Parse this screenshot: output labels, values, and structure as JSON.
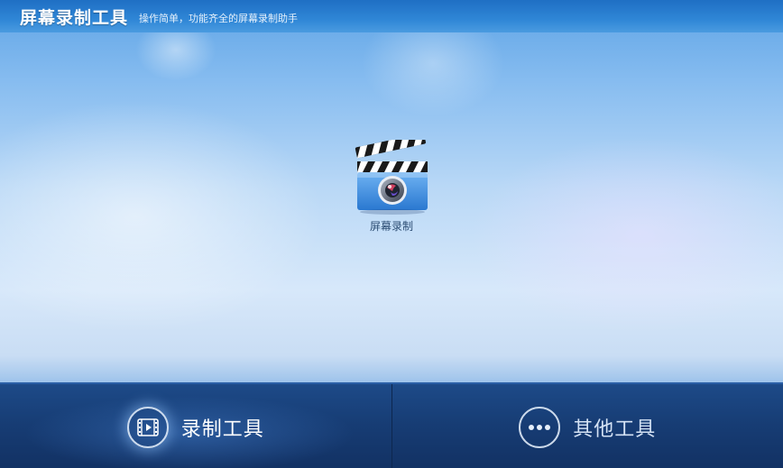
{
  "header": {
    "title": "屏幕录制工具",
    "subtitle": "操作简单，功能齐全的屏幕录制助手"
  },
  "main": {
    "tools": [
      {
        "label": "屏幕录制",
        "icon": "clapperboard-camera-icon"
      }
    ]
  },
  "bottom_tabs": [
    {
      "label": "录制工具",
      "icon": "film-icon",
      "active": true
    },
    {
      "label": "其他工具",
      "icon": "more-dots-icon",
      "active": false
    }
  ],
  "colors": {
    "header": "#2f86d6",
    "bottom_bar": "#173d75",
    "background_top": "#5ea4e6",
    "background_mid": "#d7e8fa",
    "tool_icon_blue": "#3d8fe0"
  }
}
